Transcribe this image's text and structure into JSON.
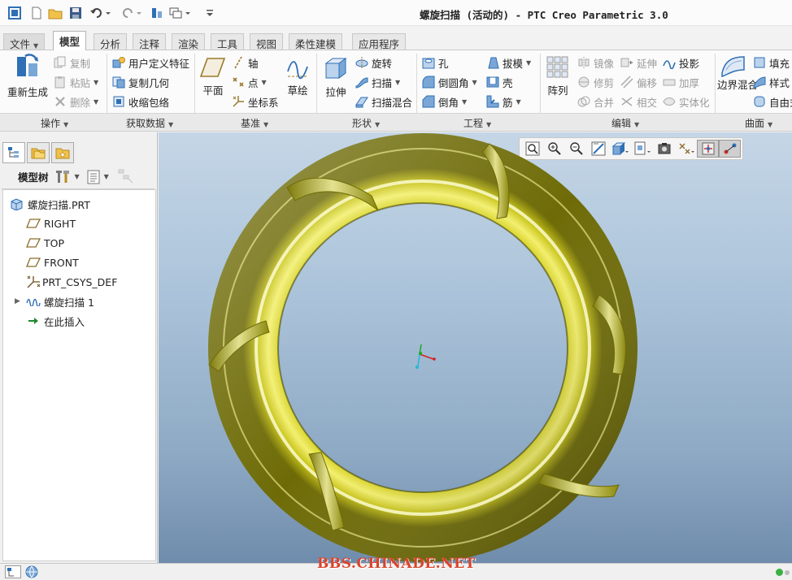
{
  "window": {
    "title": "螺旋扫描 (活动的) - PTC Creo Parametric 3.0"
  },
  "quick_access": {
    "icons": [
      "app-icon",
      "new-icon",
      "open-icon",
      "save-icon",
      "undo-icon",
      "redo-icon",
      "regenerate-icon",
      "window-switch-icon",
      "customize-icon"
    ]
  },
  "tabs": [
    {
      "label": "文件",
      "active": false,
      "dropdown": true
    },
    {
      "label": "模型",
      "active": true
    },
    {
      "label": "分析",
      "active": false
    },
    {
      "label": "注释",
      "active": false
    },
    {
      "label": "渲染",
      "active": false
    },
    {
      "label": "工具",
      "active": false
    },
    {
      "label": "视图",
      "active": false
    },
    {
      "label": "柔性建模",
      "active": false
    },
    {
      "label": "应用程序",
      "active": false
    }
  ],
  "ribbon": {
    "operations": {
      "label": "操作",
      "regenerate": "重新生成",
      "copy": "复制",
      "paste": "粘贴",
      "delete": "删除"
    },
    "get_data": {
      "label": "获取数据",
      "user_feature": "用户定义特征",
      "copy_geometry": "复制几何",
      "shrinkwrap": "收缩包络"
    },
    "datum": {
      "label": "基准",
      "plane": "平面",
      "axis": "轴",
      "point": "点",
      "csys": "坐标系",
      "sketch": "草绘"
    },
    "shapes": {
      "label": "形状",
      "extrude": "拉伸",
      "revolve": "旋转",
      "sweep": "扫描",
      "swept_blend": "扫描混合"
    },
    "engineering": {
      "label": "工程",
      "hole": "孔",
      "round": "倒圆角",
      "chamfer": "倒角",
      "draft": "拔模",
      "shell": "壳",
      "rib": "筋"
    },
    "editing": {
      "label": "编辑",
      "pattern": "阵列",
      "mirror": "镜像",
      "extend": "延伸",
      "project": "投影",
      "trim": "修剪",
      "offset": "偏移",
      "thicken": "加厚",
      "merge": "合并",
      "intersect": "相交",
      "solidify": "实体化"
    },
    "surfaces": {
      "label": "曲面",
      "boundary_blend": "边界混合",
      "fill": "填充",
      "style": "样式",
      "freestyle": "自由式"
    }
  },
  "left_panel": {
    "tree_label": "模型树",
    "items": [
      {
        "label": "螺旋扫描.PRT",
        "icon": "part-icon",
        "expandable": false
      },
      {
        "label": "RIGHT",
        "icon": "datum-plane-icon",
        "expandable": false
      },
      {
        "label": "TOP",
        "icon": "datum-plane-icon",
        "expandable": false
      },
      {
        "label": "FRONT",
        "icon": "datum-plane-icon",
        "expandable": false
      },
      {
        "label": "PRT_CSYS_DEF",
        "icon": "csys-icon",
        "expandable": false
      },
      {
        "label": "螺旋扫描 1",
        "icon": "helical-sweep-icon",
        "expandable": true
      },
      {
        "label": "在此插入",
        "icon": "insert-arrow-icon",
        "expandable": false
      }
    ]
  },
  "viewport": {
    "toolbar_icons": [
      "refit-icon",
      "zoom-in-icon",
      "zoom-out-icon",
      "repaint-icon",
      "display-style-icon",
      "saved-views-icon",
      "view-manager-icon",
      "datum-display-icon",
      "spin-center-icon",
      "annotation-display-icon"
    ],
    "model_color": "#c8c418",
    "background_top": "#c5d6e6",
    "background_bottom": "#6f8cac"
  },
  "watermark": "BBS.CHINADE.NET",
  "colors": {
    "accent": "#2f6fb5",
    "status_green": "#3cb043"
  }
}
